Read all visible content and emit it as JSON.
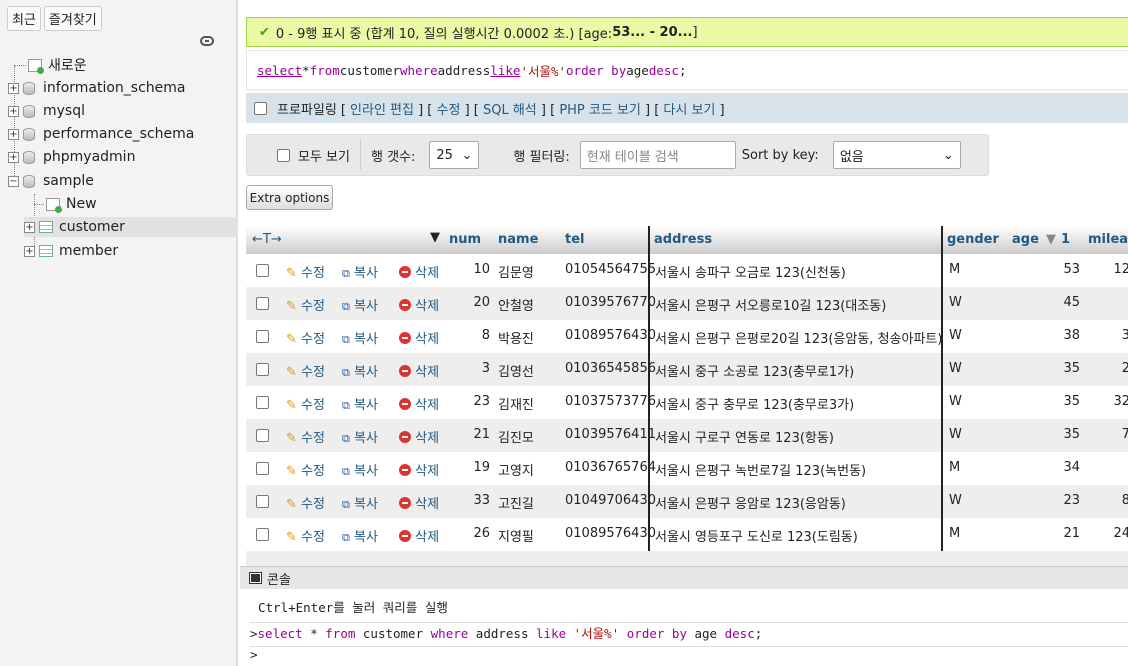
{
  "nav": {
    "top_buttons": [
      "최근",
      "즐겨찾기"
    ],
    "tree": [
      {
        "label": "새로운"
      },
      {
        "label": "information_schema"
      },
      {
        "label": "mysql"
      },
      {
        "label": "performance_schema"
      },
      {
        "label": "phpmyadmin"
      },
      {
        "label": "sample"
      },
      {
        "label": "New"
      },
      {
        "label": "customer"
      },
      {
        "label": "member"
      }
    ]
  },
  "result": {
    "success_text": "0 - 9행 표시 중 (합계 10, 질의 실행시간 0.0002 초.) [age: ",
    "success_range": "53... - 20...",
    "success_end": "]",
    "sql": {
      "select": "select",
      "star": " * ",
      "from": "from",
      "table": " customer ",
      "where": "where",
      "col": " address ",
      "like": "like",
      "str": " '서울%' ",
      "order": "order by",
      "col2": " age ",
      "desc": "desc",
      "end": ";"
    }
  },
  "profiling": {
    "label": "프로파일링",
    "links": [
      "인라인 편집",
      "수정",
      "SQL 해석",
      "PHP 코드 보기",
      "다시 보기"
    ]
  },
  "filters": {
    "show_all": "모두 보기",
    "row_count_label": "행 갯수:",
    "row_count_value": "25",
    "row_filter_label": "행 필터링:",
    "row_filter_placeholder": "현재 테이블 검색",
    "sort_label": "Sort by key:",
    "sort_value": "없음",
    "extra_options": "Extra options"
  },
  "table": {
    "arrows": "←T→",
    "columns": [
      "num",
      "name",
      "tel",
      "address",
      "gender",
      "age",
      "1",
      "mileag"
    ],
    "actions": {
      "edit": "수정",
      "copy": "복사",
      "delete": "삭제"
    },
    "rows": [
      {
        "num": "10",
        "name": "김문영",
        "tel": "01054564755",
        "address": "서울시 송파구 오금로 123(신천동)",
        "gender": "M",
        "age": "53",
        "mileage": "12"
      },
      {
        "num": "20",
        "name": "안철영",
        "tel": "01039576770",
        "address": "서울시 은평구 서오릉로10길 123(대조동)",
        "gender": "W",
        "age": "45",
        "mileage": ""
      },
      {
        "num": "8",
        "name": "박용진",
        "tel": "01089576430",
        "address": "서울시 은평구  은평로20길 123(응암동, 청송아파트)",
        "gender": "W",
        "age": "38",
        "mileage": "3"
      },
      {
        "num": "3",
        "name": "김영선",
        "tel": "01036545856",
        "address": "서울시 중구 소공로 123(충무로1가)",
        "gender": "W",
        "age": "35",
        "mileage": "2"
      },
      {
        "num": "23",
        "name": "김재진",
        "tel": "01037573776",
        "address": "서울시 중구  충무로 123(충무로3가)",
        "gender": "W",
        "age": "35",
        "mileage": "32"
      },
      {
        "num": "21",
        "name": "김진모",
        "tel": "01039576411",
        "address": "서울시 구로구 연동로 123(항동)",
        "gender": "W",
        "age": "35",
        "mileage": "7"
      },
      {
        "num": "19",
        "name": "고영지",
        "tel": "01036765764",
        "address": "서울시 은평구 녹번로7길 123(녹번동)",
        "gender": "M",
        "age": "34",
        "mileage": ""
      },
      {
        "num": "33",
        "name": "고진길",
        "tel": "01049706430",
        "address": "서울시 은평구 응암로 123(응암동)",
        "gender": "W",
        "age": "23",
        "mileage": "8"
      },
      {
        "num": "26",
        "name": "지영필",
        "tel": "01089576430",
        "address": "서울시 영등포구 도신로 123(도림동)",
        "gender": "M",
        "age": "21",
        "mileage": "24"
      }
    ]
  },
  "console": {
    "title": "콘솔",
    "hint": "Ctrl+Enter를 눌러 쿼리를 실행",
    "prompt": ">",
    "query_plain1": "select",
    "query_plain2": " * ",
    "query_from": "from",
    "query_tbl": " customer ",
    "query_where": "where",
    "query_rest": " address ",
    "query_like": "like",
    "query_str": " '서울%' ",
    "query_order": "order by",
    "query_age": " age ",
    "query_desc": "desc",
    "query_end": ";"
  }
}
